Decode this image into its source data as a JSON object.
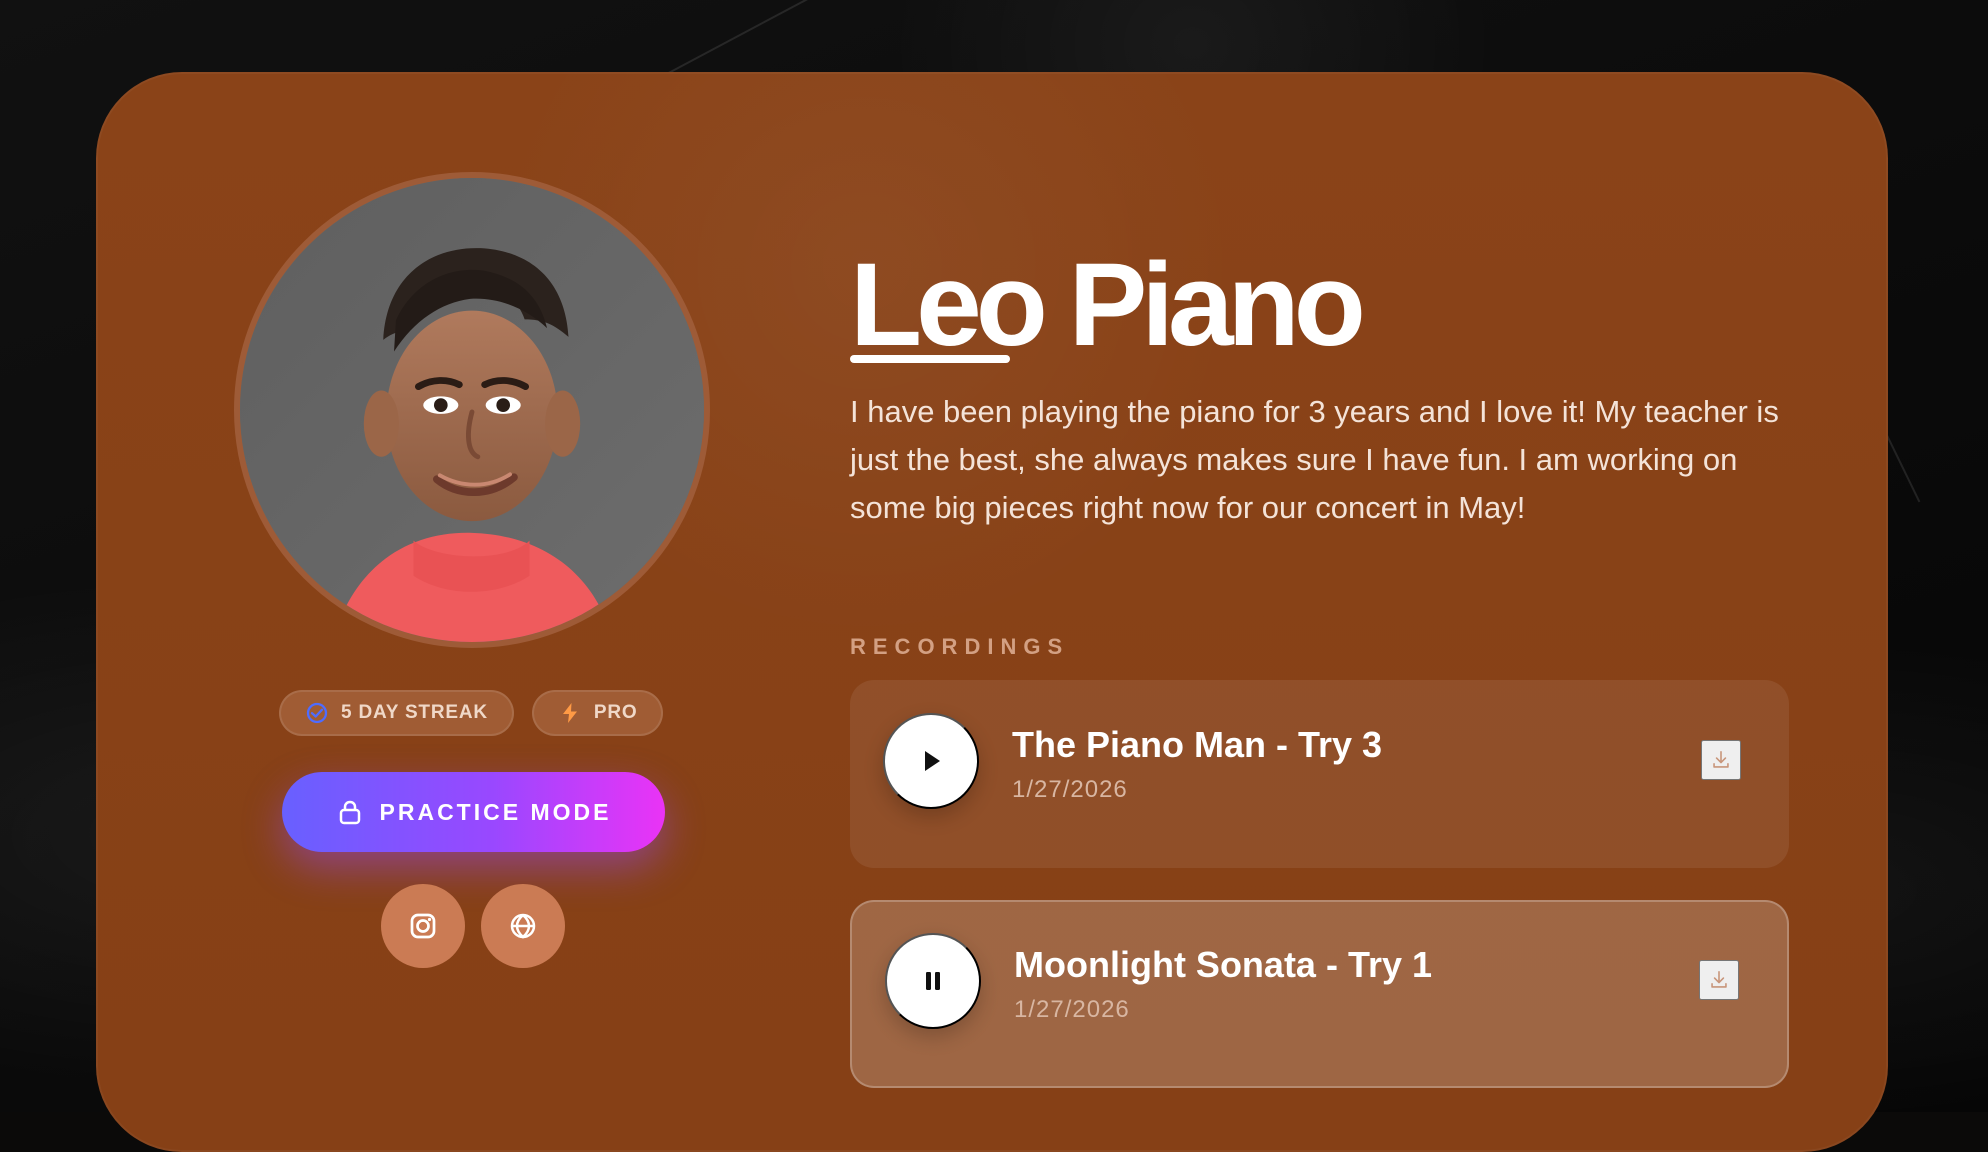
{
  "theme": {
    "page_background": "#0b0a09",
    "card_background": "#8a4318",
    "accent_gradient_start": "#6860ff",
    "accent_gradient_end": "#ea33f6",
    "social_button": "#cb7b54",
    "text_primary": "#ffffff",
    "text_secondary": "#f4e3d8",
    "section_label": "#d3a083",
    "streak_icon_color": "#4e6cff",
    "pro_icon_color": "#ff9a45"
  },
  "profile": {
    "name": "Leo Piano",
    "bio": "I have been playing the piano for 3 years and I love it! My teacher is just the best, she always makes sure I have fun. I am working on some big pieces right now for our concert in May!",
    "avatar_icon": "student-portrait-icon",
    "badges": [
      {
        "label": "5 DAY STREAK",
        "icon": "streak-icon"
      },
      {
        "label": "PRO",
        "icon": "lightning-icon"
      }
    ],
    "practice_button": {
      "label": "PRACTICE MODE",
      "icon": "lock-icon"
    },
    "social_links": [
      {
        "icon": "instagram-icon"
      },
      {
        "icon": "globe-icon"
      }
    ]
  },
  "recordings": {
    "section_label": "RECORDINGS",
    "items": [
      {
        "title": "The Piano Man - Try 3",
        "date": "1/27/2026",
        "state": "paused",
        "control_icon": "play-icon",
        "download_icon": "download-icon"
      },
      {
        "title": "Moonlight Sonata - Try 1",
        "date": "1/27/2026",
        "state": "playing",
        "control_icon": "pause-icon",
        "download_icon": "download-icon"
      }
    ]
  }
}
